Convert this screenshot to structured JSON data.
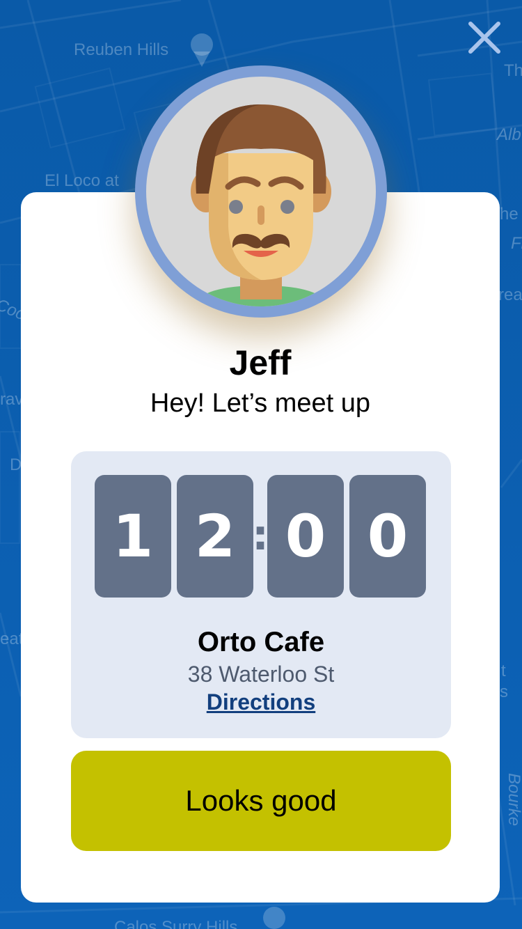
{
  "map": {
    "labels": [
      "Reuben Hills",
      "El Loco at",
      "Th",
      "Alb",
      "he",
      "Fl",
      "rea",
      "Coo",
      "rav",
      "D",
      "eat",
      "t",
      "s",
      "Bourke",
      "Calos Surry Hills"
    ]
  },
  "colors": {
    "map_background": "#0c5fb0",
    "avatar_ring": "#7f9fd6",
    "digit_tile": "#637189",
    "info_panel": "#e3e9f4",
    "confirm_button": "#c4c100",
    "directions_link": "#123f7e"
  },
  "close_button": {
    "icon": "close-icon"
  },
  "contact": {
    "name": "Jeff",
    "message": "Hey! Let’s meet up",
    "avatar_icon": "man-with-mustache-avatar"
  },
  "meeting": {
    "time_digits": [
      "1",
      "2",
      "0",
      "0"
    ],
    "separator": ":",
    "venue_name": "Orto Cafe",
    "venue_address": "38 Waterloo St",
    "directions_label": "Directions"
  },
  "confirm_button": {
    "label": "Looks good"
  }
}
